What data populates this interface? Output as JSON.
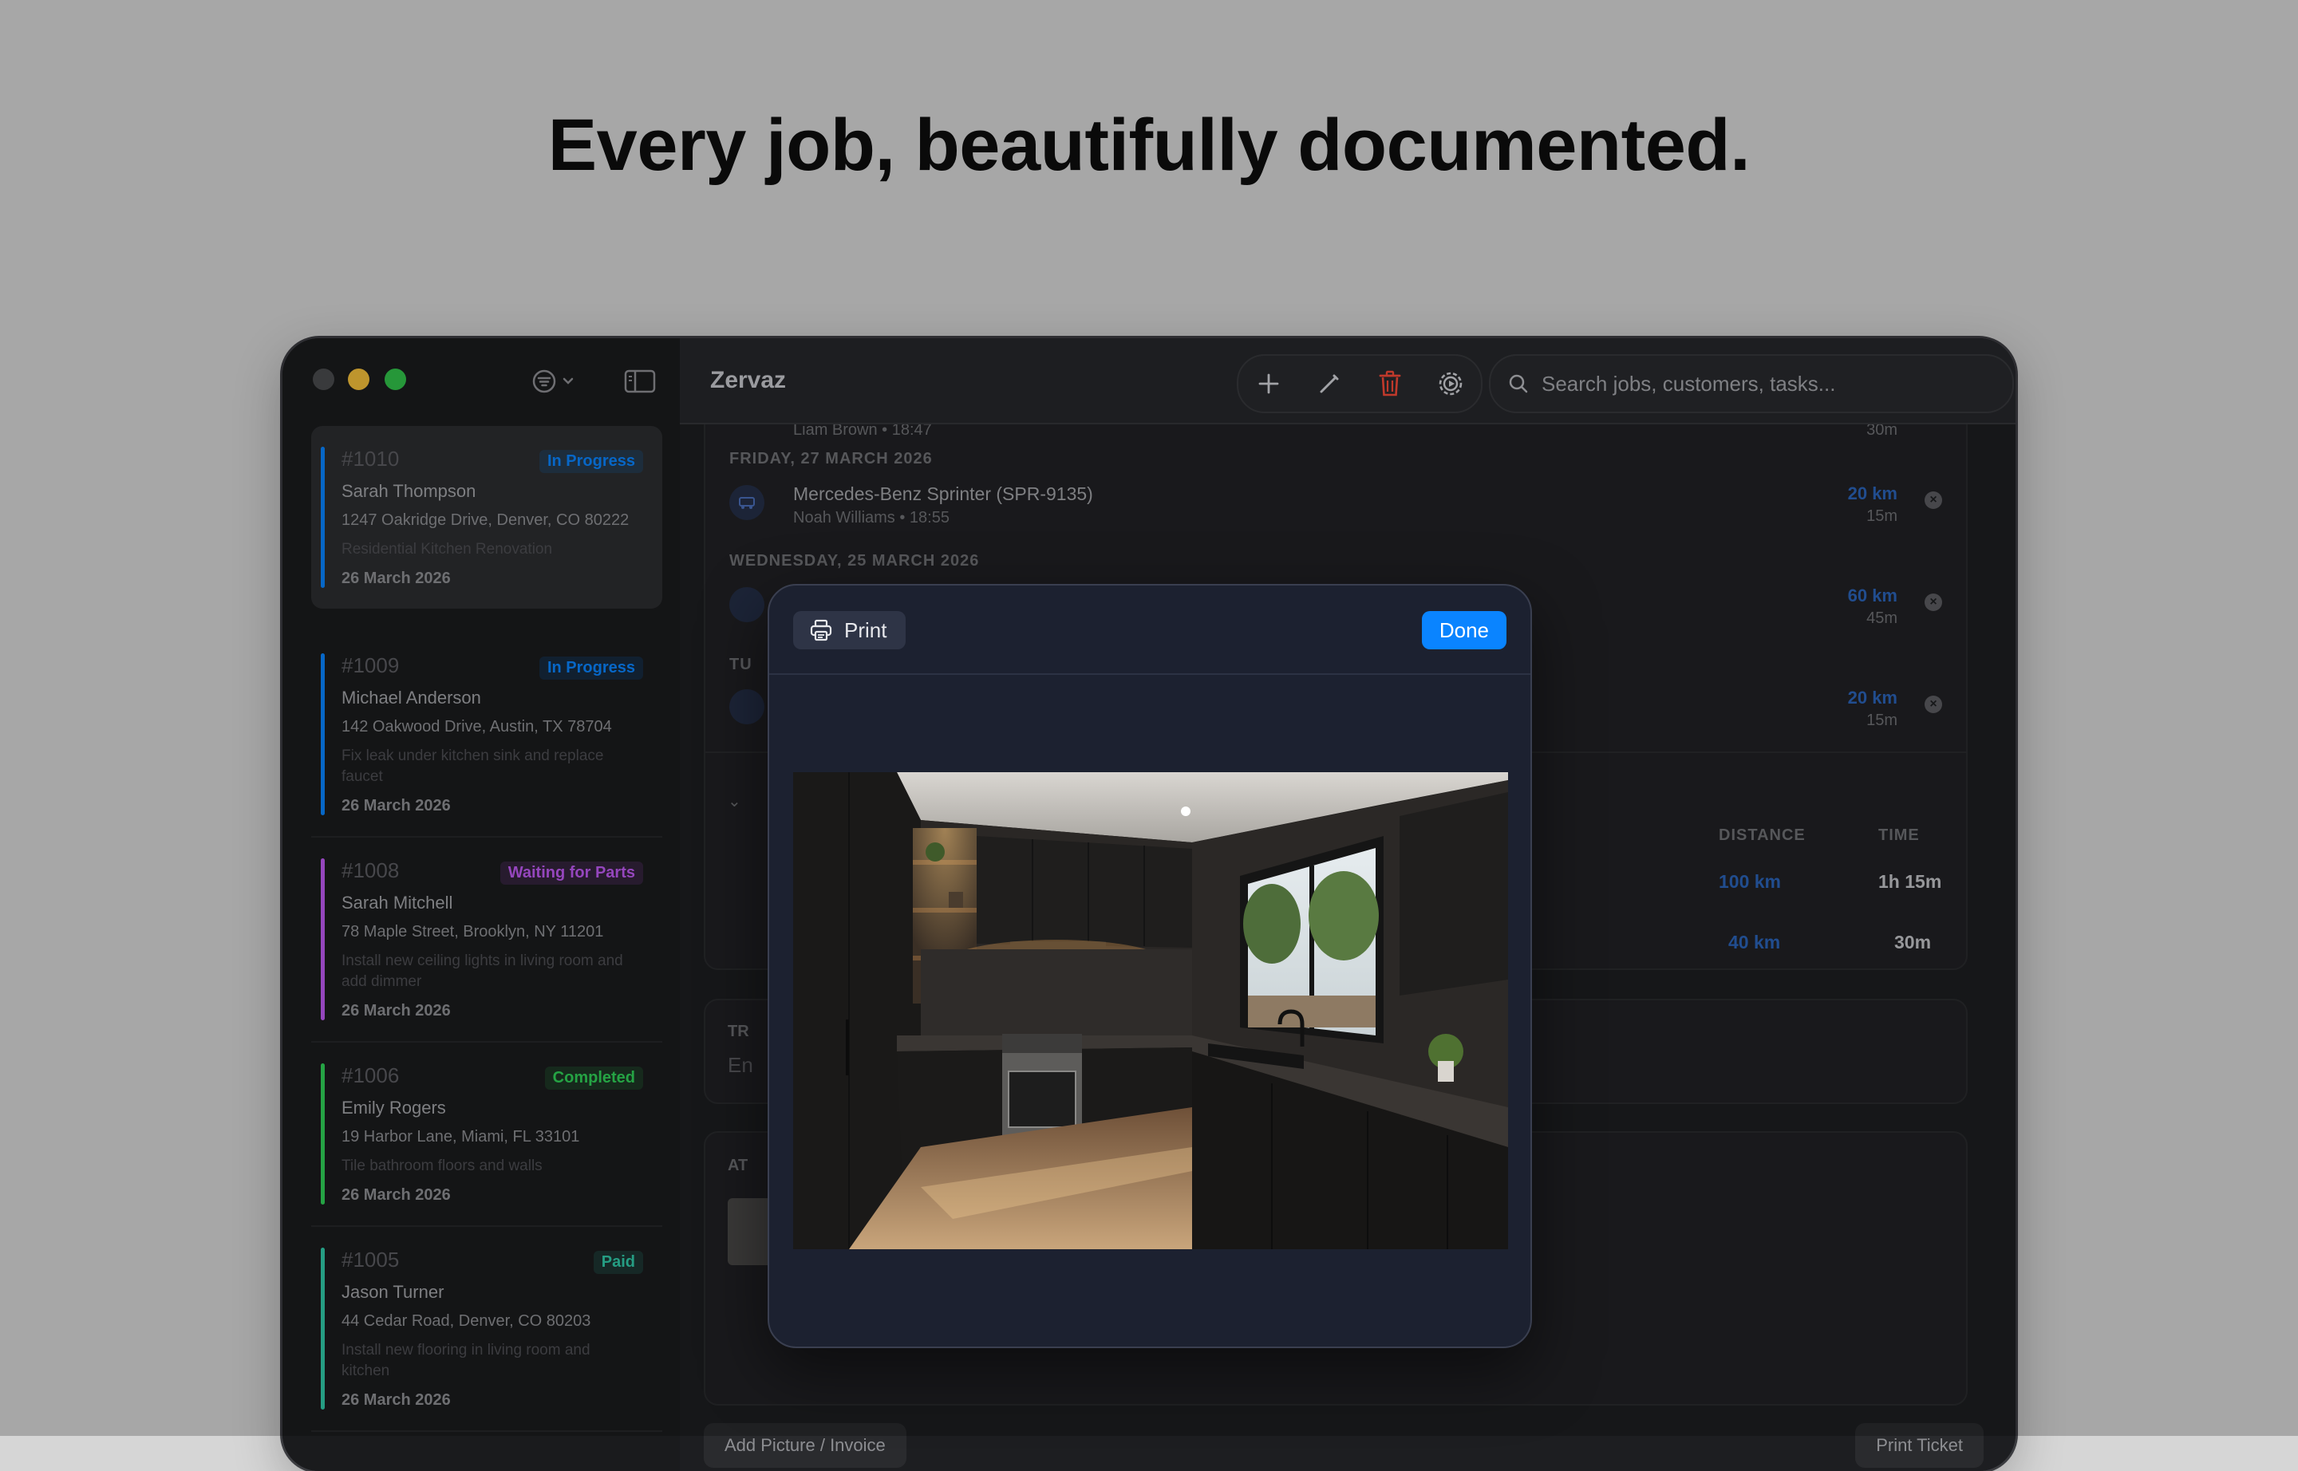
{
  "headline": "Every job, beautifully documented.",
  "app": {
    "title": "Zervaz"
  },
  "colors": {
    "accent": "#0a84ff",
    "in_progress": "#0a84ff",
    "waiting": "#bf5af2",
    "completed": "#30d158",
    "paid": "#30c9a8",
    "delete": "#c0392b"
  },
  "search": {
    "placeholder": "Search jobs, customers, tasks..."
  },
  "toolbar": {
    "icons": [
      "plus-icon",
      "pencil-icon",
      "trash-icon",
      "gear-icon"
    ]
  },
  "jobs": [
    {
      "number": "#1010",
      "status": "In Progress",
      "status_color": "#0a84ff",
      "customer": "Sarah Thompson",
      "address": "1247 Oakridge Drive, Denver, CO 80222",
      "description": "Residential Kitchen Renovation",
      "date": "26 March 2026"
    },
    {
      "number": "#1009",
      "status": "In Progress",
      "status_color": "#0a84ff",
      "customer": "Michael Anderson",
      "address": "142 Oakwood Drive, Austin, TX 78704",
      "description": "Fix leak under kitchen sink and replace faucet",
      "date": "26 March 2026"
    },
    {
      "number": "#1008",
      "status": "Waiting for Parts",
      "status_color": "#bf5af2",
      "customer": "Sarah Mitchell",
      "address": "78 Maple Street, Brooklyn, NY 11201",
      "description": "Install new ceiling lights in living room and add dimmer",
      "date": "26 March 2026"
    },
    {
      "number": "#1006",
      "status": "Completed",
      "status_color": "#30d158",
      "customer": "Emily Rogers",
      "address": "19 Harbor Lane, Miami, FL 33101",
      "description": "Tile bathroom floors and walls",
      "date": "26 March 2026"
    },
    {
      "number": "#1005",
      "status": "Paid",
      "status_color": "#30c9a8",
      "customer": "Jason Turner",
      "address": "44 Cedar Road, Denver, CO 80203",
      "description": "Install new flooring in living room and kitchen",
      "date": "26 March 2026"
    }
  ],
  "trips": {
    "top_meta": "Liam Brown • 18:47",
    "top_time": "30m",
    "days": [
      {
        "heading": "FRIDAY, 27 MARCH 2026",
        "vehicle": "Mercedes-Benz Sprinter (SPR-9135)",
        "meta": "Noah Williams • 18:55",
        "distance": "20 km",
        "time": "15m"
      },
      {
        "heading": "WEDNESDAY, 25 MARCH 2026",
        "vehicle": "",
        "meta": "",
        "distance": "60 km",
        "time": "45m"
      },
      {
        "heading": "TU",
        "vehicle": "",
        "meta": "",
        "distance": "20 km",
        "time": "15m"
      }
    ],
    "summary": {
      "distance_header": "DISTANCE",
      "time_header": "TIME",
      "rows": [
        {
          "distance": "100 km",
          "time": "1h 15m"
        },
        {
          "distance": "40 km",
          "time": "30m"
        }
      ]
    }
  },
  "partial": {
    "tr_label": "TR",
    "en_text": "En",
    "at_label": "AT",
    "add_picture": "Add Picture / Invoice",
    "print_ticket": "Print Ticket"
  },
  "modal": {
    "print_label": "Print",
    "done_label": "Done"
  }
}
